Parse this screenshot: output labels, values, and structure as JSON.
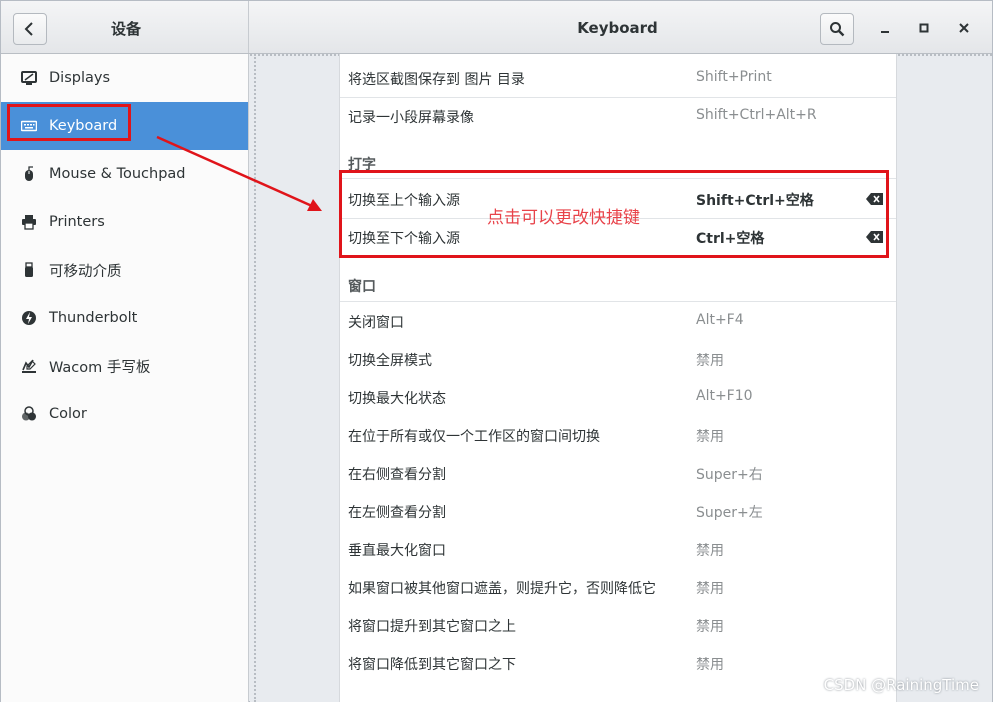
{
  "header": {
    "left_title": "设备",
    "title": "Keyboard",
    "back_icon": "back-chevron-icon",
    "search_icon": "search-icon"
  },
  "sidebar": {
    "items": [
      {
        "label": "Displays",
        "icon": "display-icon"
      },
      {
        "label": "Keyboard",
        "icon": "keyboard-icon",
        "active": true
      },
      {
        "label": "Mouse & Touchpad",
        "icon": "mouse-icon"
      },
      {
        "label": "Printers",
        "icon": "printer-icon"
      },
      {
        "label": "可移动介质",
        "icon": "usb-drive-icon"
      },
      {
        "label": "Thunderbolt",
        "icon": "thunderbolt-icon"
      },
      {
        "label": "Wacom 手写板",
        "icon": "tablet-icon"
      },
      {
        "label": "Color",
        "icon": "color-icon"
      }
    ]
  },
  "shortcuts": {
    "top_rows": [
      {
        "name": "将选区截图保存到 图片 目录",
        "accel": "Shift+Print"
      },
      {
        "name": "记录一小段屏幕录像",
        "accel": "Shift+Ctrl+Alt+R"
      }
    ],
    "typing_section": "打字",
    "typing_rows": [
      {
        "name": "切换至上个输入源",
        "accel": "Shift+Ctrl+空格"
      },
      {
        "name": "切换至下个输入源",
        "accel": "Ctrl+空格"
      }
    ],
    "window_section": "窗口",
    "window_rows": [
      {
        "name": "关闭窗口",
        "accel": "Alt+F4"
      },
      {
        "name": "切换全屏模式",
        "accel": "禁用"
      },
      {
        "name": "切换最大化状态",
        "accel": "Alt+F10"
      },
      {
        "name": "在位于所有或仅一个工作区的窗口间切换",
        "accel": "禁用"
      },
      {
        "name": "在右侧查看分割",
        "accel": "Super+右"
      },
      {
        "name": "在左侧查看分割",
        "accel": "Super+左"
      },
      {
        "name": "垂直最大化窗口",
        "accel": "禁用"
      },
      {
        "name": "如果窗口被其他窗口遮盖，则提升它，否则降低它",
        "accel": "禁用"
      },
      {
        "name": "将窗口提升到其它窗口之上",
        "accel": "禁用"
      },
      {
        "name": "将窗口降低到其它窗口之下",
        "accel": "禁用"
      }
    ]
  },
  "annotation": {
    "text": "点击可以更改快捷键",
    "color": "#e0141a"
  },
  "watermark": "CSDN @RainingTime",
  "colors": {
    "accent": "#4a90d9",
    "annotation_red": "#e0141a"
  }
}
